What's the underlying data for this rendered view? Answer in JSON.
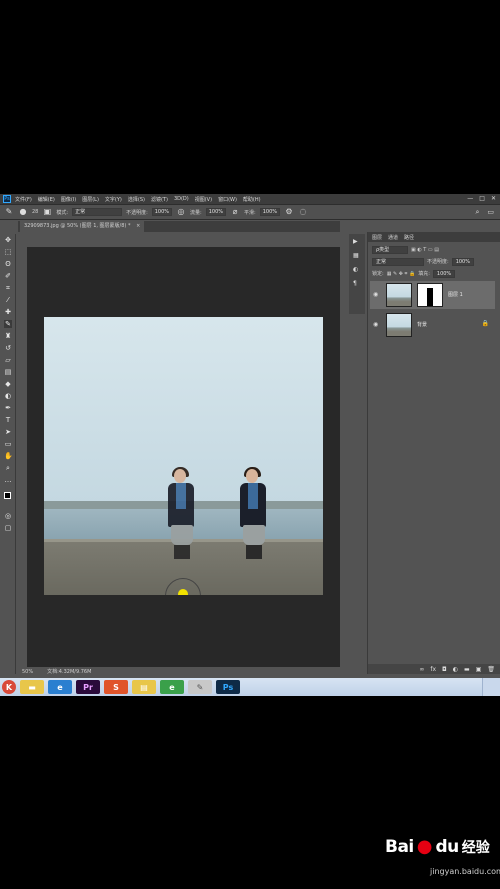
{
  "app": {
    "name": "Adobe Photoshop",
    "logo": "Ps"
  },
  "menubar": {
    "items": [
      "文件(F)",
      "编辑(E)",
      "图像(I)",
      "图层(L)",
      "文字(Y)",
      "选择(S)",
      "滤镜(T)",
      "3D(D)",
      "视图(V)",
      "窗口(W)",
      "帮助(H)"
    ],
    "window_controls": [
      "—",
      "□",
      "✕"
    ]
  },
  "options_bar": {
    "brush_size": "28",
    "mode_label": "模式:",
    "mode_value": "正常",
    "opacity_label": "不透明度:",
    "opacity_value": "100%",
    "flow_label": "流量:",
    "flow_value": "100%",
    "smooth_label": "平滑:",
    "smooth_value": "100%"
  },
  "document_tab": {
    "title": "32909873.jpg @ 50% (图层 1, 图层蒙版/8) *",
    "close": "×"
  },
  "status_bar": {
    "zoom": "50%",
    "doc_info": "文档:4.32M/9.76M"
  },
  "layers_panel": {
    "tabs": [
      "图层",
      "通道",
      "路径"
    ],
    "filter_label": "ρ类型",
    "blend_mode": "正常",
    "opacity_label": "不透明度:",
    "opacity_value": "100%",
    "lock_label": "锁定:",
    "fill_label": "填充:",
    "fill_value": "100%",
    "layers": [
      {
        "name": "图层 1",
        "selected": true,
        "has_mask": true
      },
      {
        "name": "背景",
        "selected": false,
        "locked": true
      }
    ],
    "bottom_icons": [
      "link-icon",
      "fx-icon",
      "mask-icon",
      "adjustment-icon",
      "folder-icon",
      "new-layer-icon",
      "trash-icon"
    ]
  },
  "taskbar": {
    "buttons": [
      {
        "icon": "k-icon",
        "color": "#d94a3a"
      },
      {
        "icon": "folder-icon",
        "color": "#e8c64a"
      },
      {
        "icon": "ie-icon",
        "color": "#2a7fd0"
      },
      {
        "icon": "premiere-icon",
        "color": "#2a0a3a"
      },
      {
        "icon": "s-icon",
        "color": "#e0542a"
      },
      {
        "icon": "explorer-icon",
        "color": "#e8c64a"
      },
      {
        "icon": "browser-icon",
        "color": "#3aa04a"
      },
      {
        "icon": "paint-icon",
        "color": "#c8c8c8"
      },
      {
        "icon": "photoshop-icon",
        "color": "#0e2a47"
      }
    ]
  },
  "watermark": {
    "brand": "Bai",
    "brand2": "du",
    "cn": "经验",
    "url": "jingyan.baidu.com"
  },
  "colors": {
    "accent_yellow": "#f2e200",
    "ps_blue": "#31a8ff"
  }
}
